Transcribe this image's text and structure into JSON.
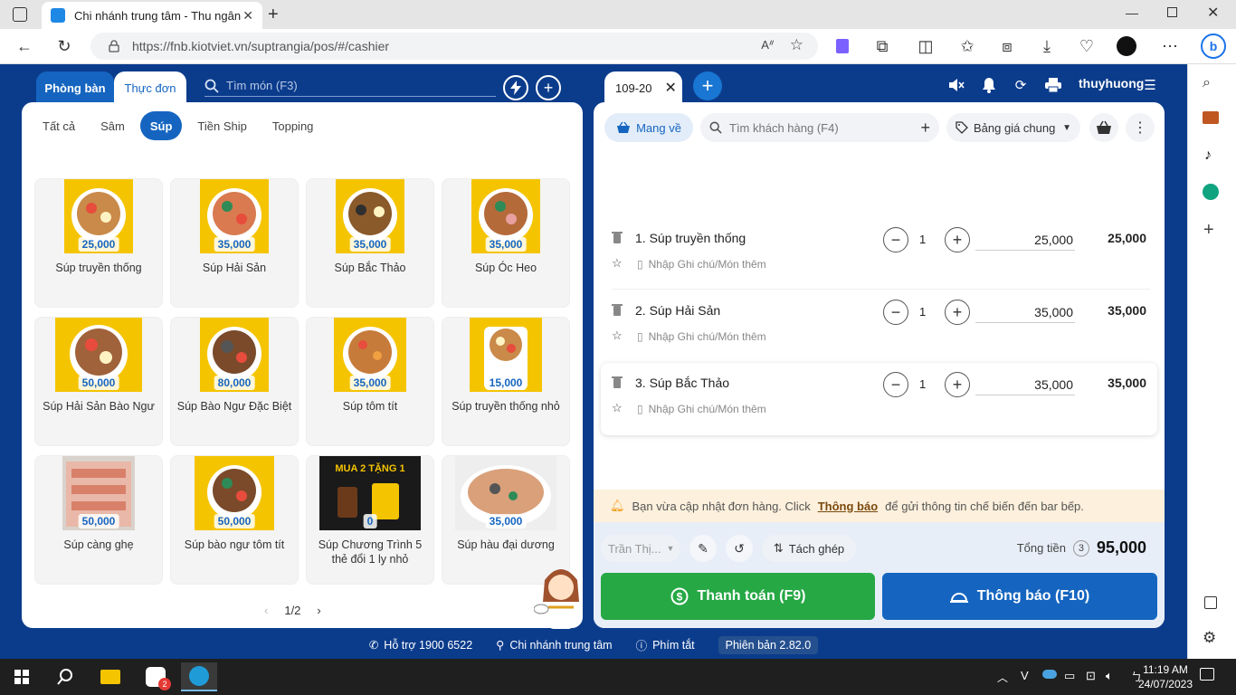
{
  "browser": {
    "tab_title": "Chi nhánh trung tâm - Thu ngân",
    "url": "https://fnb.kiotviet.vn/suptrangia/pos/#/cashier"
  },
  "left": {
    "tabs": [
      {
        "label": "Phòng bàn"
      },
      {
        "label": "Thực đơn"
      }
    ],
    "search_placeholder": "Tìm món (F3)",
    "categories": [
      "Tất cả",
      "Sâm",
      "Súp",
      "Tiền Ship",
      "Topping"
    ],
    "products": [
      {
        "name": "Súp truyền thống",
        "price": "25,000"
      },
      {
        "name": "Súp Hải Sản",
        "price": "35,000"
      },
      {
        "name": "Súp Bắc Thảo",
        "price": "35,000"
      },
      {
        "name": "Súp Óc Heo",
        "price": "35,000"
      },
      {
        "name": "Súp Hải Sản Bào Ngư",
        "price": "50,000"
      },
      {
        "name": "Súp Bào Ngư Đặc Biệt",
        "price": "80,000"
      },
      {
        "name": "Súp tôm tít",
        "price": "35,000"
      },
      {
        "name": "Súp truyền thống nhỏ",
        "price": "15,000"
      },
      {
        "name": "Súp càng ghẹ",
        "price": "50,000"
      },
      {
        "name": "Súp bào ngư tôm tít",
        "price": "50,000"
      },
      {
        "name": "Súp Chương Trình 5 thẻ đổi 1 ly nhỏ",
        "price": "0"
      },
      {
        "name": "Súp hàu đại dương",
        "price": "35,000"
      }
    ],
    "pager": "1/2",
    "promo_text": "MUA 2 TẶNG 1"
  },
  "right": {
    "order_tab": "109-20",
    "username": "thuyhuong",
    "takeaway_label": "Mang về",
    "customer_placeholder": "Tìm khách hàng (F4)",
    "pricelist": "Bảng giá chung",
    "lines": [
      {
        "name": "1. Súp truyền thống",
        "qty": "1",
        "unit_price": "25,000",
        "total": "25,000",
        "note_placeholder": "Nhập Ghi chú/Món thêm"
      },
      {
        "name": "2. Súp Hải Sản",
        "qty": "1",
        "unit_price": "35,000",
        "total": "35,000",
        "note_placeholder": "Nhập Ghi chú/Món thêm"
      },
      {
        "name": "3. Súp Bắc Thảo",
        "qty": "1",
        "unit_price": "35,000",
        "total": "35,000",
        "note_placeholder": "Nhập Ghi chú/Món thêm"
      }
    ],
    "notice": {
      "before": "Bạn vừa cập nhật đơn hàng. Click",
      "link": "Thông báo",
      "after": "để gửi thông tin chế biến đến bar bếp."
    },
    "waiter": "Trần Thị...",
    "split_label": "Tách ghép",
    "total_label": "Tổng tiền",
    "total_count": "3",
    "total_amount": "95,000",
    "pay_label": "Thanh toán (F9)",
    "notify_label": "Thông báo (F10)"
  },
  "footer": {
    "support": "Hỗ trợ 1900 6522",
    "branch": "Chi nhánh trung tâm",
    "shortcuts": "Phím tắt",
    "version": "Phiên bản 2.82.0"
  },
  "taskbar": {
    "time": "11:19 AM",
    "date": "24/07/2023",
    "zalo_badge": "2"
  },
  "colors": {
    "app_bg": "#0b3c8c",
    "primary": "#1565c0",
    "pay_green": "#26a845",
    "notice_bg": "#fdf0dc"
  }
}
